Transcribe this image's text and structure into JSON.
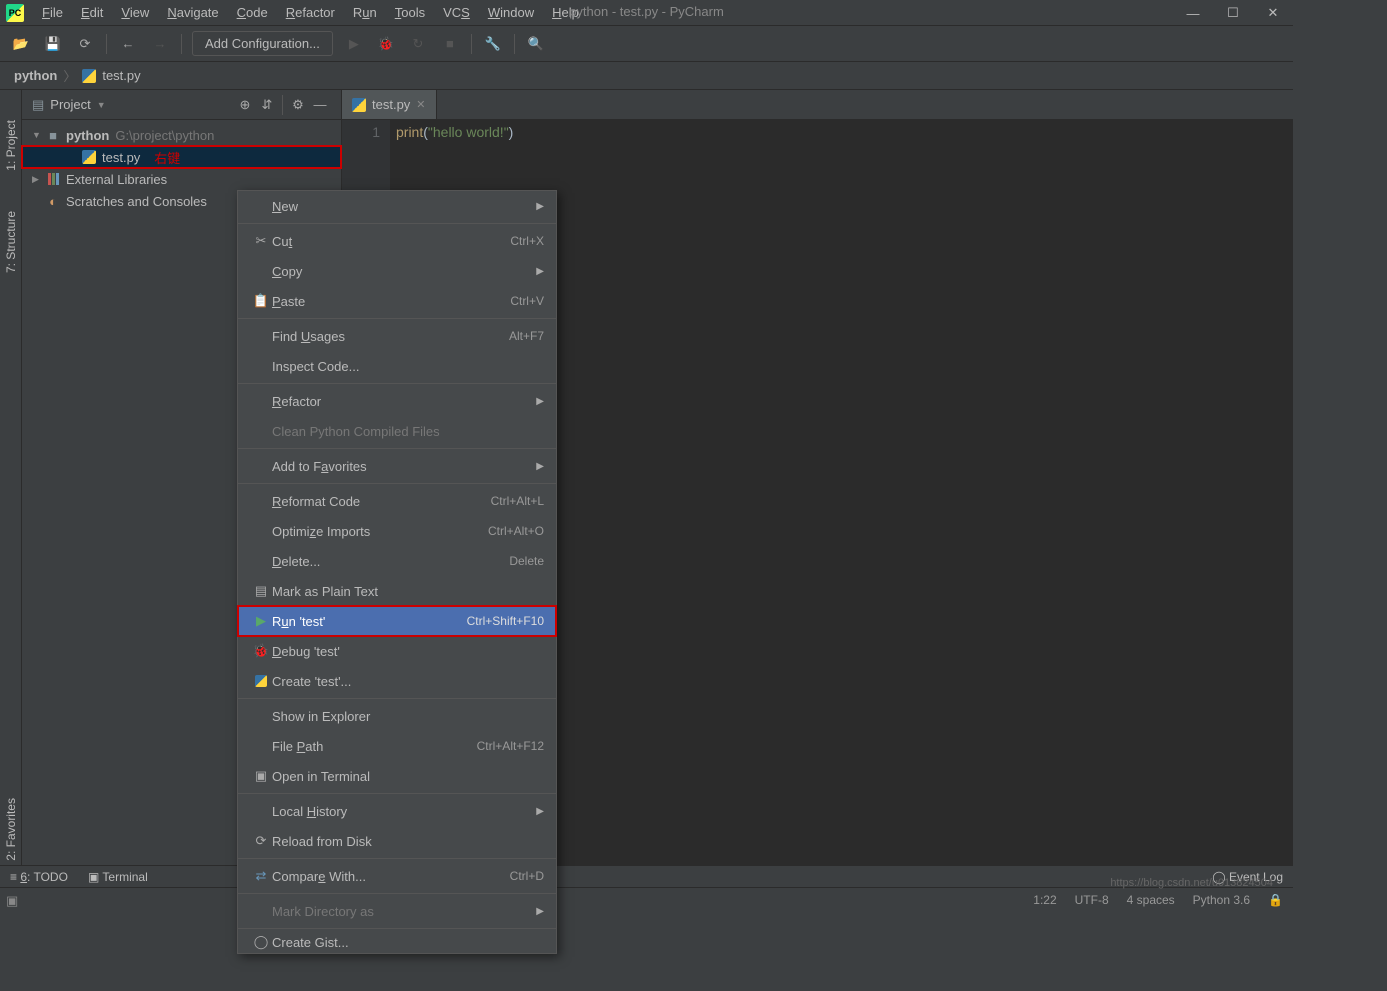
{
  "window": {
    "title": "python - test.py - PyCharm"
  },
  "menus": {
    "file": "File",
    "edit": "Edit",
    "view": "View",
    "navigate": "Navigate",
    "code": "Code",
    "refactor": "Refactor",
    "run": "Run",
    "tools": "Tools",
    "vcs": "VCS",
    "window": "Window",
    "help": "Help"
  },
  "toolbar": {
    "runConfig": "Add Configuration..."
  },
  "breadcrumb": {
    "root": "python",
    "file": "test.py"
  },
  "sideTabs": {
    "project": "1: Project",
    "structure": "7: Structure",
    "favorites": "2: Favorites"
  },
  "panel": {
    "title": "Project"
  },
  "tree": {
    "root": {
      "name": "python",
      "path": "G:\\project\\python"
    },
    "file": "test.py",
    "fileNote": "右键",
    "ext": "External Libraries",
    "scratch": "Scratches and Consoles"
  },
  "editor": {
    "tab": "test.py",
    "lineNum": "1",
    "codeFn": "print",
    "codeParenOpen": "(",
    "codeStr": "\"hello world!\"",
    "codeParenClose": ")"
  },
  "contextMenu": {
    "new": "New",
    "cut": "Cut",
    "cutKey": "Ctrl+X",
    "copy": "Copy",
    "paste": "Paste",
    "pasteKey": "Ctrl+V",
    "findUsages": "Find Usages",
    "findUsagesKey": "Alt+F7",
    "inspect": "Inspect Code...",
    "refactor": "Refactor",
    "clean": "Clean Python Compiled Files",
    "addFav": "Add to Favorites",
    "reformat": "Reformat Code",
    "reformatKey": "Ctrl+Alt+L",
    "optimize": "Optimize Imports",
    "optimizeKey": "Ctrl+Alt+O",
    "delete": "Delete...",
    "deleteKey": "Delete",
    "markPlain": "Mark as Plain Text",
    "runTest": "Run 'test'",
    "runTestKey": "Ctrl+Shift+F10",
    "debugTest": "Debug 'test'",
    "createTest": "Create 'test'...",
    "showExplorer": "Show in Explorer",
    "filePath": "File Path",
    "filePathKey": "Ctrl+Alt+F12",
    "openTerminal": "Open in Terminal",
    "localHistory": "Local History",
    "reload": "Reload from Disk",
    "compare": "Compare With...",
    "compareKey": "Ctrl+D",
    "markDir": "Mark Directory as",
    "gist": "Create Gist..."
  },
  "bottomBar": {
    "todo": "6: TODO",
    "terminal": "Terminal",
    "eventLog": "Event Log"
  },
  "statusBar": {
    "pos": "1:22",
    "encoding": "UTF-8",
    "indent": "4 spaces",
    "python": "Python 3.6"
  },
  "watermark": "https://blog.csdn.net/u013824504"
}
